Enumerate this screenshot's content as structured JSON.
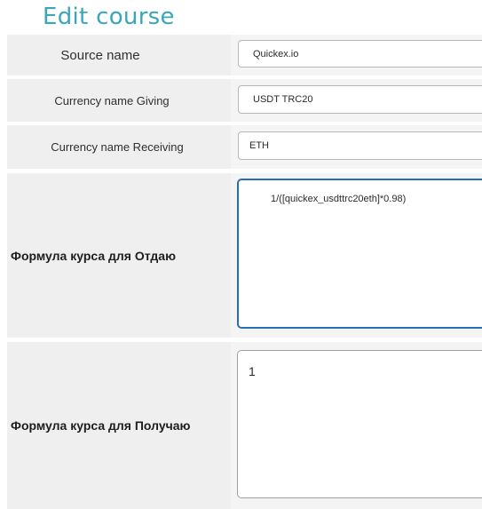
{
  "page": {
    "title": "Edit course"
  },
  "form": {
    "source_name": {
      "label": "Source name",
      "value": "Quickex.io"
    },
    "currency_giving": {
      "label": "Currency name Giving",
      "value": "USDT TRC20"
    },
    "currency_receiving": {
      "label": "Currency name Receiving",
      "value": "ETH"
    },
    "formula_give": {
      "label": "Формула курса для Отдаю",
      "value": "1/([quickex_usdttrc20eth]*0.98)"
    },
    "formula_get": {
      "label": "Формула курса для Получаю",
      "value": "1"
    }
  },
  "colors": {
    "title": "#3aa6b9",
    "label_background": "#efefef",
    "focus_border": "#2a6db5"
  }
}
